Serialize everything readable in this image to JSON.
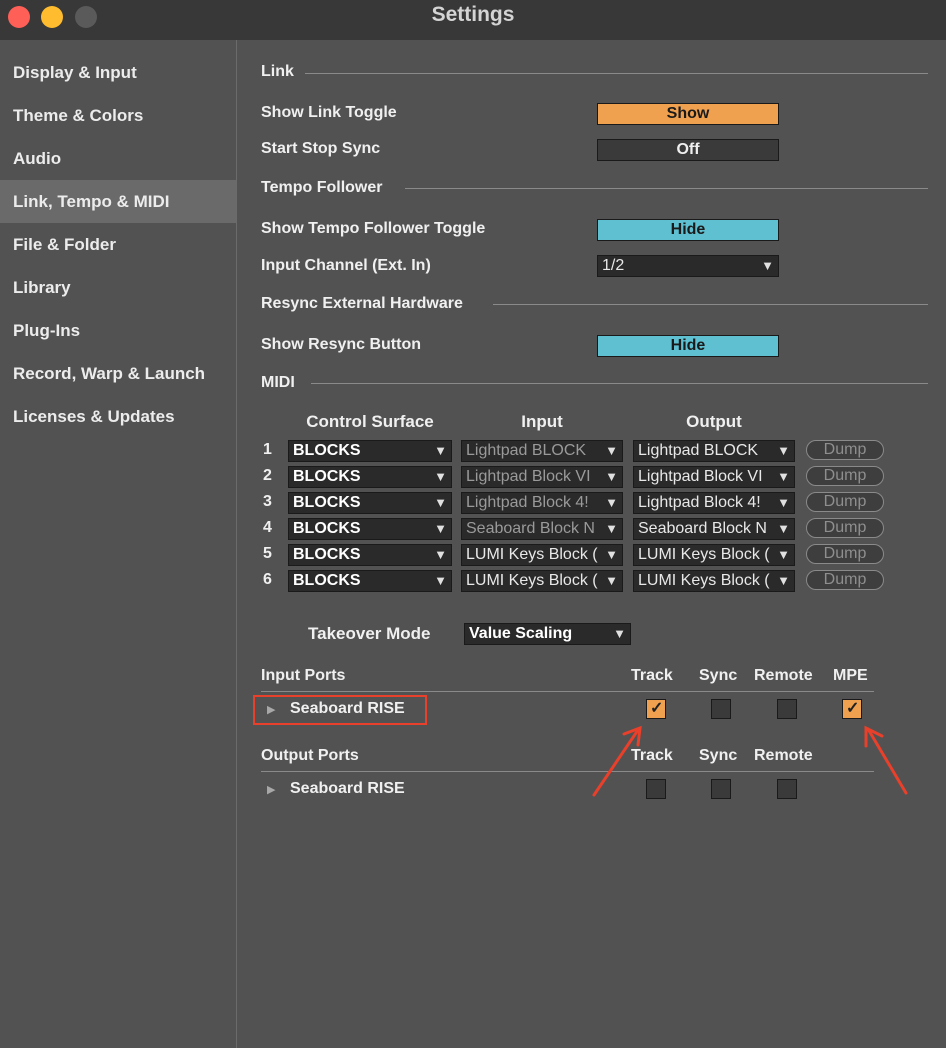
{
  "window": {
    "title": "Settings",
    "traffic_colors": [
      "#fe5f57",
      "#febc2e",
      "#5a5a5a"
    ]
  },
  "sidebar": {
    "items": [
      {
        "label": "Display & Input"
      },
      {
        "label": "Theme & Colors"
      },
      {
        "label": "Audio"
      },
      {
        "label": "Link, Tempo & MIDI",
        "active": true
      },
      {
        "label": "File & Folder"
      },
      {
        "label": "Library"
      },
      {
        "label": "Plug-Ins"
      },
      {
        "label": "Record, Warp & Launch"
      },
      {
        "label": "Licenses & Updates"
      }
    ]
  },
  "link": {
    "section": "Link",
    "show_toggle_label": "Show Link Toggle",
    "show_toggle_value": "Show",
    "start_stop_label": "Start Stop Sync",
    "start_stop_value": "Off"
  },
  "tempo": {
    "section": "Tempo Follower",
    "show_toggle_label": "Show Tempo Follower Toggle",
    "show_toggle_value": "Hide",
    "input_channel_label": "Input Channel (Ext. In)",
    "input_channel_value": "1/2"
  },
  "resync": {
    "section": "Resync External Hardware",
    "button_label": "Show Resync Button",
    "button_value": "Hide"
  },
  "midi": {
    "section": "MIDI",
    "headers": {
      "control_surface": "Control Surface",
      "input": "Input",
      "output": "Output"
    },
    "rows": [
      {
        "num": "1",
        "surface": "BLOCKS",
        "input": "Lightpad BLOCK",
        "output": "Lightpad BLOCK",
        "dump": "Dump"
      },
      {
        "num": "2",
        "surface": "BLOCKS",
        "input": "Lightpad Block VI",
        "output": "Lightpad Block VI",
        "dump": "Dump"
      },
      {
        "num": "3",
        "surface": "BLOCKS",
        "input": "Lightpad Block 4!",
        "output": "Lightpad Block 4!",
        "dump": "Dump"
      },
      {
        "num": "4",
        "surface": "BLOCKS",
        "input": "Seaboard Block N",
        "output": "Seaboard Block N",
        "dump": "Dump"
      },
      {
        "num": "5",
        "surface": "BLOCKS",
        "input": "LUMI Keys Block (",
        "output": "LUMI Keys Block (",
        "dump": "Dump"
      },
      {
        "num": "6",
        "surface": "BLOCKS",
        "input": "LUMI Keys Block (",
        "output": "LUMI Keys Block (",
        "dump": "Dump"
      }
    ],
    "takeover_label": "Takeover Mode",
    "takeover_value": "Value Scaling"
  },
  "input_ports": {
    "title": "Input Ports",
    "cols": [
      "Track",
      "Sync",
      "Remote",
      "MPE"
    ],
    "port": "Seaboard RISE",
    "checked": [
      true,
      false,
      false,
      true
    ]
  },
  "output_ports": {
    "title": "Output Ports",
    "cols": [
      "Track",
      "Sync",
      "Remote"
    ],
    "port": "Seaboard RISE",
    "checked": [
      false,
      false,
      false
    ]
  },
  "annotation_color": "#e8402a"
}
